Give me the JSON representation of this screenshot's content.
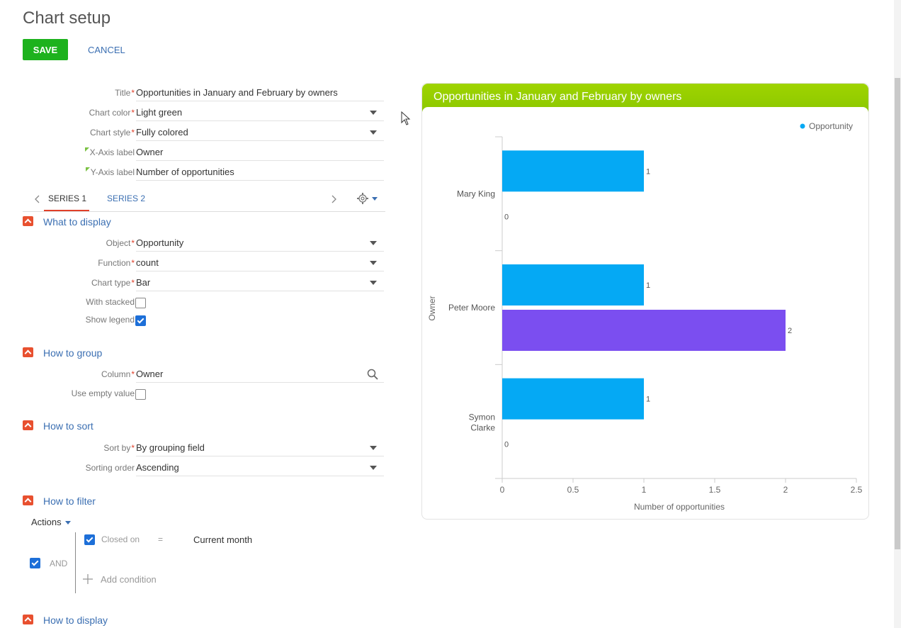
{
  "page": {
    "title": "Chart setup",
    "save": "SAVE",
    "cancel": "CANCEL"
  },
  "fields": {
    "title": {
      "label": "Title",
      "value": "Opportunities in January and February by owners"
    },
    "chart_color": {
      "label": "Chart color",
      "value": "Light green"
    },
    "chart_style": {
      "label": "Chart style",
      "value": "Fully colored"
    },
    "x_axis_label": {
      "label": "X-Axis label",
      "value": "Owner"
    },
    "y_axis_label": {
      "label": "Y-Axis label",
      "value": "Number of opportunities"
    }
  },
  "tabs": {
    "series1": "SERIES 1",
    "series2": "SERIES 2"
  },
  "what_to_display": {
    "title": "What to display",
    "object": {
      "label": "Object",
      "value": "Opportunity"
    },
    "function": {
      "label": "Function",
      "value": "count"
    },
    "chart_type": {
      "label": "Chart type",
      "value": "Bar"
    },
    "with_stacked": {
      "label": "With stacked",
      "checked": false
    },
    "show_legend": {
      "label": "Show legend",
      "checked": true
    }
  },
  "how_to_group": {
    "title": "How to group",
    "column": {
      "label": "Column",
      "value": "Owner"
    },
    "use_empty_value": {
      "label": "Use empty value",
      "checked": false
    }
  },
  "how_to_sort": {
    "title": "How to sort",
    "sort_by": {
      "label": "Sort by",
      "value": "By grouping field"
    },
    "sorting_order": {
      "label": "Sorting order",
      "value": "Ascending"
    }
  },
  "how_to_filter": {
    "title": "How to filter",
    "actions": "Actions",
    "and_label": "AND",
    "condition": {
      "field": "Closed on",
      "operator": "=",
      "value": "Current month"
    },
    "add_condition": "Add condition"
  },
  "how_to_display": {
    "title": "How to display"
  },
  "colors": {
    "save": "#1db21d",
    "header": "#96cf00",
    "series_blue": "#05a9f4",
    "series_purple": "#7b4ef0",
    "accent_red": "#e8502f"
  },
  "chart_data": {
    "type": "bar",
    "orientation": "horizontal",
    "title": "Opportunities in January and February by owners",
    "xlabel": "Number of opportunities",
    "ylabel": "Owner",
    "categories": [
      "Mary King",
      "Peter Moore",
      "Symon Clarke"
    ],
    "series": [
      {
        "name": "Opportunity",
        "values": [
          1,
          1,
          1
        ],
        "color": "#05a9f4"
      },
      {
        "values": [
          0,
          2,
          0
        ],
        "color": "#7b4ef0"
      }
    ],
    "xlim": [
      0,
      2.5
    ],
    "xticks": [
      "0",
      "0.5",
      "1",
      "1.5",
      "2",
      "2.5"
    ],
    "legend": "top-right",
    "grid": false
  }
}
